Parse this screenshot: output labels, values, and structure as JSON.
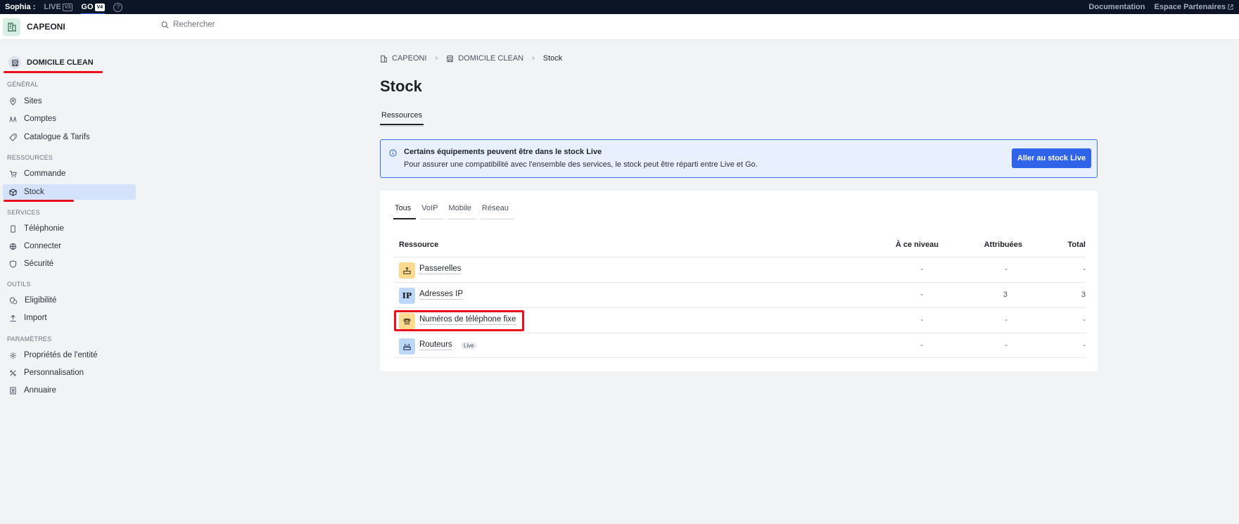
{
  "topbar": {
    "user": "Sophia :",
    "env_live": "LIVE",
    "env_live_badge": "V3",
    "env_go": "GO",
    "env_go_badge": "V4",
    "help": "?",
    "links": [
      "Documentation",
      "Espace Partenaires"
    ]
  },
  "header": {
    "brand": "CAPEONI",
    "search_placeholder": "Rechercher"
  },
  "sidebar": {
    "entity": "DOMICILE CLEAN",
    "sections": {
      "general": "GÉNÉRAL",
      "ressources": "RESSOURCES",
      "services": "SERVICES",
      "outils": "OUTILS",
      "parametres": "PARAMÈTRES"
    },
    "items": {
      "sites": "Sites",
      "comptes": "Comptes",
      "catalogue": "Catalogue & Tarifs",
      "commande": "Commande",
      "stock": "Stock",
      "telephonie": "Téléphonie",
      "connecter": "Connecter",
      "securite": "Sécurité",
      "eligibilite": "Eligibilité",
      "import": "Import",
      "proprietes": "Propriétés de l'entité",
      "personnalisation": "Personnalisation",
      "annuaire": "Annuaire"
    }
  },
  "breadcrumb": [
    "CAPEONI",
    "DOMICILE CLEAN",
    "Stock"
  ],
  "page": {
    "title": "Stock",
    "tab": "Ressources"
  },
  "alert": {
    "title": "Certains équipements peuvent être dans le stock Live",
    "text": "Pour assurer une compatibilité avec l'ensemble des services, le stock peut être réparti entre Live et Go.",
    "button": "Aller au stock Live"
  },
  "filters": [
    "Tous",
    "VoIP",
    "Mobile",
    "Réseau"
  ],
  "table": {
    "headers": {
      "resource": "Ressource",
      "level": "À ce niveau",
      "assigned": "Attribuées",
      "total": "Total"
    },
    "rows": [
      {
        "name": "Passerelles",
        "icon": "gateway-icon",
        "level": "-",
        "assigned": "-",
        "total": "-"
      },
      {
        "name": "Adresses IP",
        "icon": "ip-icon",
        "icon_text": "IP",
        "level": "-",
        "assigned": "3",
        "total": "3"
      },
      {
        "name": "Numéros de téléphone fixe",
        "icon": "phone-icon",
        "level": "-",
        "assigned": "-",
        "total": "-"
      },
      {
        "name": "Routeurs",
        "icon": "router-icon",
        "badge": "Live",
        "level": "-",
        "assigned": "-",
        "total": "-"
      }
    ]
  },
  "colors": {
    "accent": "#2f63e8",
    "highlight": "#e8101a",
    "topbar": "#0b1526"
  }
}
